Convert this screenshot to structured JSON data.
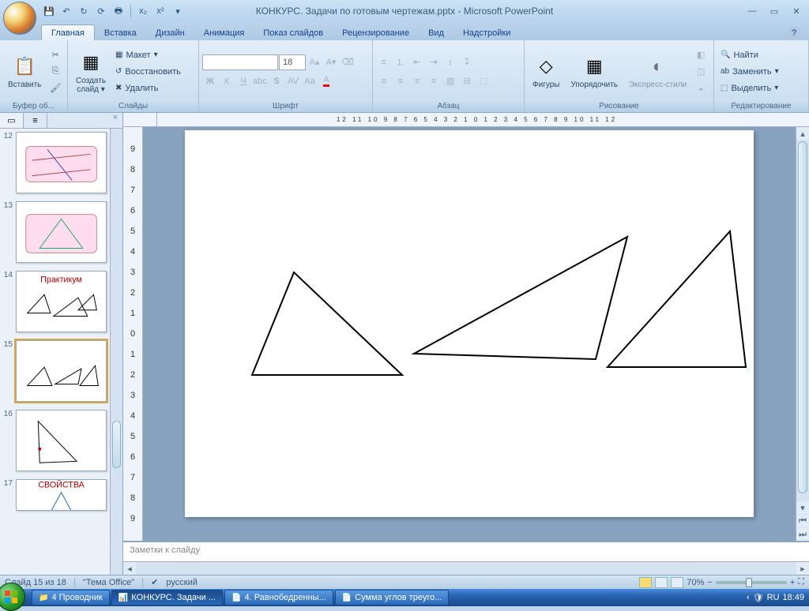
{
  "title": "КОНКУРС. Задачи по готовым чертежам.pptx - Microsoft PowerPoint",
  "ribbon": {
    "tabs": [
      "Главная",
      "Вставка",
      "Дизайн",
      "Анимация",
      "Показ слайдов",
      "Рецензирование",
      "Вид",
      "Надстройки"
    ],
    "active_tab": 0,
    "groups": {
      "clipboard": {
        "label": "Буфер об...",
        "paste": "Вставить"
      },
      "slides": {
        "label": "Слайды",
        "new_slide": "Создать\nслайд",
        "layout": "Макет",
        "reset": "Восстановить",
        "delete": "Удалить"
      },
      "font": {
        "label": "Шрифт",
        "size": "18"
      },
      "paragraph": {
        "label": "Абзац"
      },
      "drawing": {
        "label": "Рисование",
        "shapes": "Фигуры",
        "arrange": "Упорядочить",
        "styles": "Экспресс-стили"
      },
      "editing": {
        "label": "Редактирование",
        "find": "Найти",
        "replace": "Заменить",
        "select": "Выделить"
      }
    }
  },
  "thumbs": [
    "12",
    "13",
    "14",
    "15",
    "16",
    "17"
  ],
  "active_thumb": 3,
  "ruler": "12 11 10 9 8 7 6 5 4 3 2 1 0 1 2 3 4 5 6 7 8 9 10 11 12",
  "vruler": [
    "9",
    "8",
    "7",
    "6",
    "5",
    "4",
    "3",
    "2",
    "1",
    "0",
    "1",
    "2",
    "3",
    "4",
    "5",
    "6",
    "7",
    "8",
    "9"
  ],
  "notes_placeholder": "Заметки к слайду",
  "status": {
    "slide": "Слайд 15 из 18",
    "theme": "\"Тема Office\"",
    "lang": "русский",
    "zoom": "70%"
  },
  "taskbar": {
    "items": [
      {
        "label": "4 Проводник",
        "count": "4"
      },
      {
        "label": "КОНКУРС. Задачи ..."
      },
      {
        "label": "4. Равнобедренны..."
      },
      {
        "label": "Сумма углов треуго..."
      }
    ],
    "time": "18:49"
  }
}
